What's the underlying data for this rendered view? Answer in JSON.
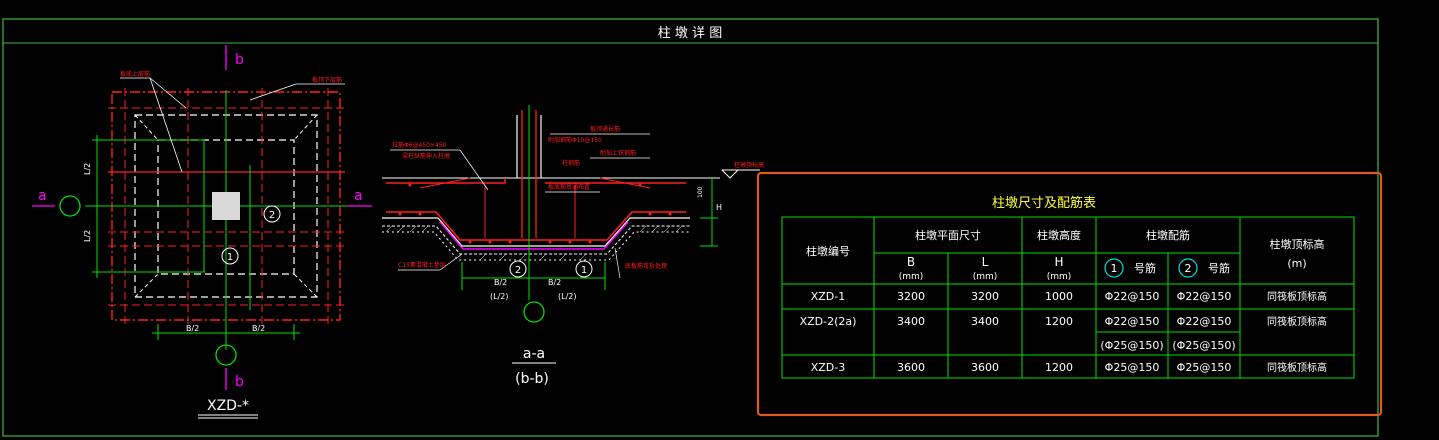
{
  "frame": {
    "title": "柱 墩 详 图"
  },
  "plan": {
    "title": "XZD-*",
    "section_a": "a",
    "section_b": "b",
    "mark_1": "1",
    "mark_2": "2",
    "dim_L2": "L/2",
    "dim_B2": "B/2",
    "note_top": "板底上层筋",
    "note_top_right": "板顶下层筋"
  },
  "section": {
    "title_top": "a-a",
    "title_bottom": "(b-b)",
    "mark_1": "1",
    "mark_2": "2",
    "dim_B2": "B/2",
    "dim_L2_paren": "(L/2)",
    "dim_H": "H",
    "dim_100": "100",
    "note_1": "板顶通长筋",
    "note_2": "附加钢筋Φ10@150",
    "note_3": "梁柱纵筋伸入柱墩",
    "note_4": "柱钢筋",
    "note_5": "附加上铁钢筋",
    "note_6": "C15素混凝土垫层",
    "note_7": "板底筋贯通布置",
    "note_8": "底板筋弯折处理",
    "note_9": "柱墩顶标高",
    "note_10": "拉筋Φ6@450×450"
  },
  "table": {
    "title": "柱墩尺寸及配筋表",
    "headers": {
      "id": "柱墩编号",
      "plan_size": "柱墩平面尺寸",
      "height": "柱墩高度",
      "rebar": "柱墩配筋",
      "top_elev": "柱墩顶标高",
      "B": "B",
      "L": "L",
      "H": "H",
      "mm": "(mm)",
      "rebar1_num": "1",
      "rebar1_label": "号筋",
      "rebar2_num": "2",
      "rebar2_label": "号筋",
      "m": "(m)"
    },
    "rows": [
      {
        "id": "XZD-1",
        "b": "3200",
        "l": "3200",
        "h": "1000",
        "r1": "Φ22@150",
        "r2": "Φ22@150",
        "elev": "同筏板顶标高"
      },
      {
        "id": "XZD-2(2a)",
        "b": "3400",
        "l": "3400",
        "h": "1200",
        "r1": "Φ22@150",
        "r2": "Φ22@150",
        "elev": "同筏板顶标高"
      },
      {
        "id": "",
        "b": "",
        "l": "",
        "h": "",
        "r1": "(Φ25@150)",
        "r2": "(Φ25@150)",
        "elev": ""
      },
      {
        "id": "XZD-3",
        "b": "3600",
        "l": "3600",
        "h": "1200",
        "r1": "Φ25@150",
        "r2": "Φ25@150",
        "elev": "同筏板顶标高"
      }
    ]
  },
  "colors": {
    "background": "#000000",
    "frame": "#3fb93f",
    "rebar_red": "#ff2020",
    "dim_green": "#00e000",
    "white": "#ffffff",
    "yellow": "#ffff40",
    "magenta": "#ff00ff",
    "highlight_box": "#e05a1a"
  }
}
